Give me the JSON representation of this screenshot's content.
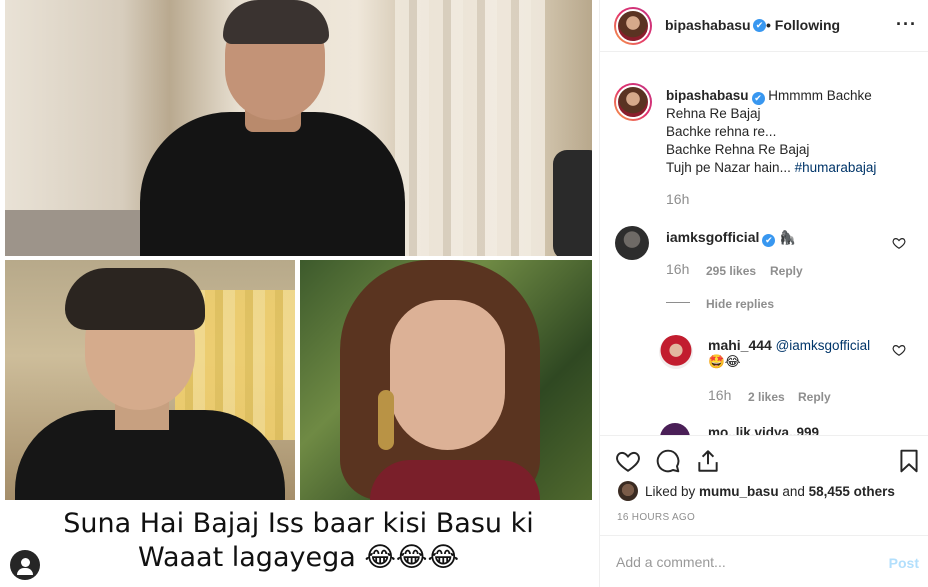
{
  "post": {
    "caption_line1": "Suna Hai Bajaj Iss baar kisi Basu ki",
    "caption_line2": "Waaat lagayega 😂😂😂"
  },
  "header": {
    "username": "bipashabasu",
    "verified_mark": "✔",
    "follow_status": "• Following",
    "more": "···"
  },
  "caption": {
    "username": "bipashabasu",
    "line1": "Hmmmm Bachke",
    "line2": "Rehna Re Bajaj",
    "line3": "Bachke rehna re...",
    "line4": "Bachke Rehna Re Bajaj",
    "line5": "Tujh pe Nazar hain...",
    "hashtag": "#humarabajaj",
    "time": "16h"
  },
  "comments": [
    {
      "username": "iamksgofficial",
      "text": "🦍",
      "time": "16h",
      "likes": "295 likes",
      "reply": "Reply",
      "hide_replies": "Hide replies"
    }
  ],
  "reply": {
    "username": "mahi_444",
    "mention": "@iamksgofficial",
    "text": "🤩😂",
    "time": "16h",
    "likes": "2 likes",
    "reply": "Reply"
  },
  "peek": {
    "username": "mo..lik.vidya..999"
  },
  "likes": {
    "prefix": "Liked by ",
    "user": "mumu_basu",
    "middle": " and ",
    "count": "58,455 others"
  },
  "posted_ago": "16 HOURS AGO",
  "add_comment": {
    "placeholder": "Add a comment...",
    "post": "Post"
  },
  "icons": [
    "heart-icon",
    "comment-icon",
    "share-icon",
    "bookmark-icon",
    "user-icon",
    "more-icon",
    "verified-icon"
  ]
}
